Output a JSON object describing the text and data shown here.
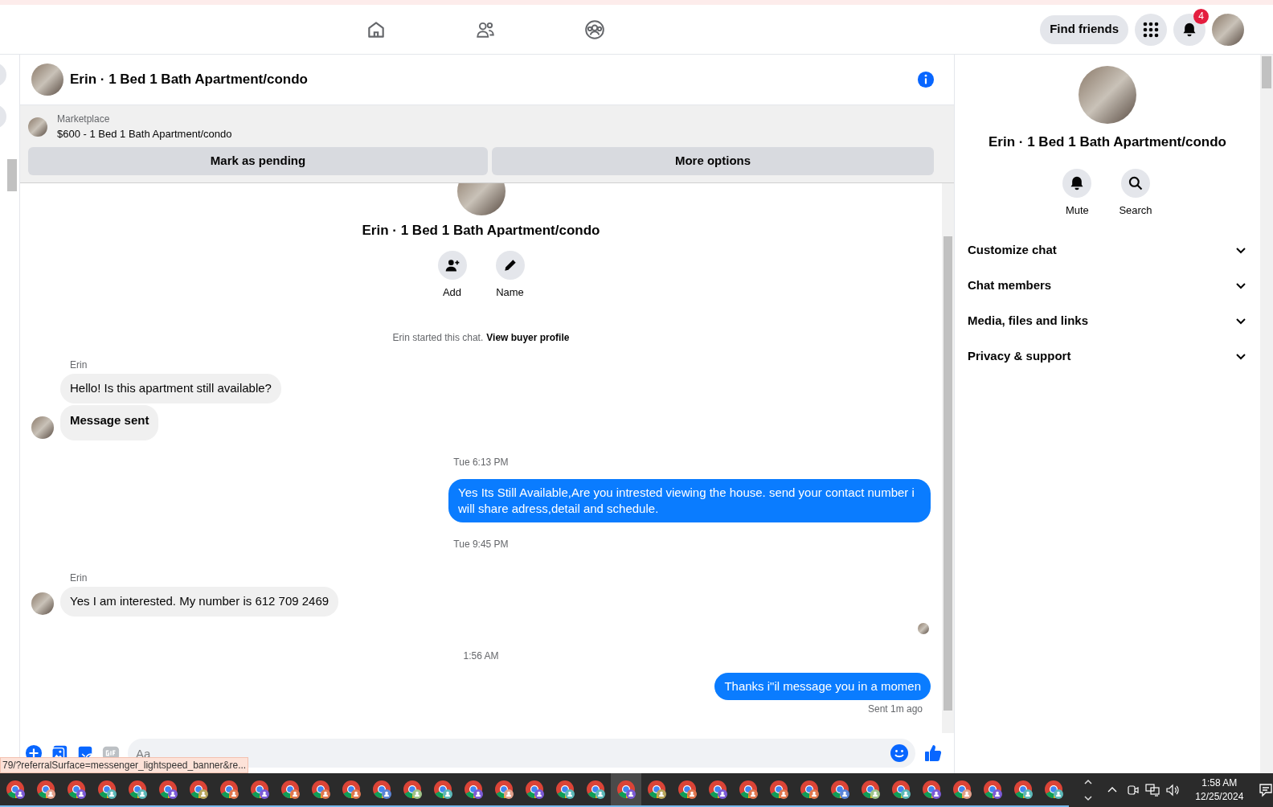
{
  "top_nav": {
    "find_friends": "Find friends",
    "notification_count": "4"
  },
  "chat_header": {
    "title": "Erin · 1 Bed 1 Bath Apartment/condo"
  },
  "listing": {
    "source": "Marketplace",
    "title": "$600 - 1 Bed 1 Bath Apartment/condo",
    "buttons": [
      "Mark as pending",
      "More options"
    ]
  },
  "thread_intro": {
    "title": "Erin · 1 Bed 1 Bath Apartment/condo",
    "actions": [
      {
        "label": "Add",
        "kind": "add"
      },
      {
        "label": "Name",
        "kind": "name"
      }
    ],
    "notice_text": "Erin started this chat.",
    "notice_link": "View buyer profile"
  },
  "messages": [
    {
      "kind": "sender",
      "text": "Erin"
    },
    {
      "kind": "incoming",
      "text": "Hello! Is this apartment still available?",
      "avatar": false,
      "bold": false
    },
    {
      "kind": "incoming",
      "text": "Message sent",
      "avatar": true,
      "bold": true
    },
    {
      "kind": "time",
      "text": "Tue 6:13 PM"
    },
    {
      "kind": "outgoing",
      "text": "Yes Its Still Available,Are you intrested viewing the house. send your contact number i will share adress,detail and schedule."
    },
    {
      "kind": "time",
      "text": "Tue 9:45 PM"
    },
    {
      "kind": "sender",
      "text": "Erin"
    },
    {
      "kind": "incoming",
      "text": "Yes I am interested. My number is 612 709 2469",
      "avatar": true,
      "bold": false
    },
    {
      "kind": "read_receipt"
    },
    {
      "kind": "time",
      "text": "1:56 AM"
    },
    {
      "kind": "outgoing",
      "text": "Thanks i\"il message you in a momen"
    },
    {
      "kind": "status",
      "text": "Sent 1m ago"
    }
  ],
  "composer": {
    "placeholder": "Aa"
  },
  "details_panel": {
    "title": "Erin · 1 Bed 1 Bath Apartment/condo",
    "actions": [
      {
        "label": "Mute",
        "kind": "mute"
      },
      {
        "label": "Search",
        "kind": "search"
      }
    ],
    "sections": [
      {
        "label": "Customize chat",
        "expanded": false
      },
      {
        "label": "Chat members",
        "expanded": false
      },
      {
        "label": "Media, files and links",
        "expanded": false
      },
      {
        "label": "Privacy & support",
        "expanded": false
      }
    ]
  },
  "link_preview": "79/?referralSurface=messenger_lightspeed_banner&re...",
  "taskbar": {
    "time": "1:58 AM",
    "date": "12/25/2024"
  }
}
